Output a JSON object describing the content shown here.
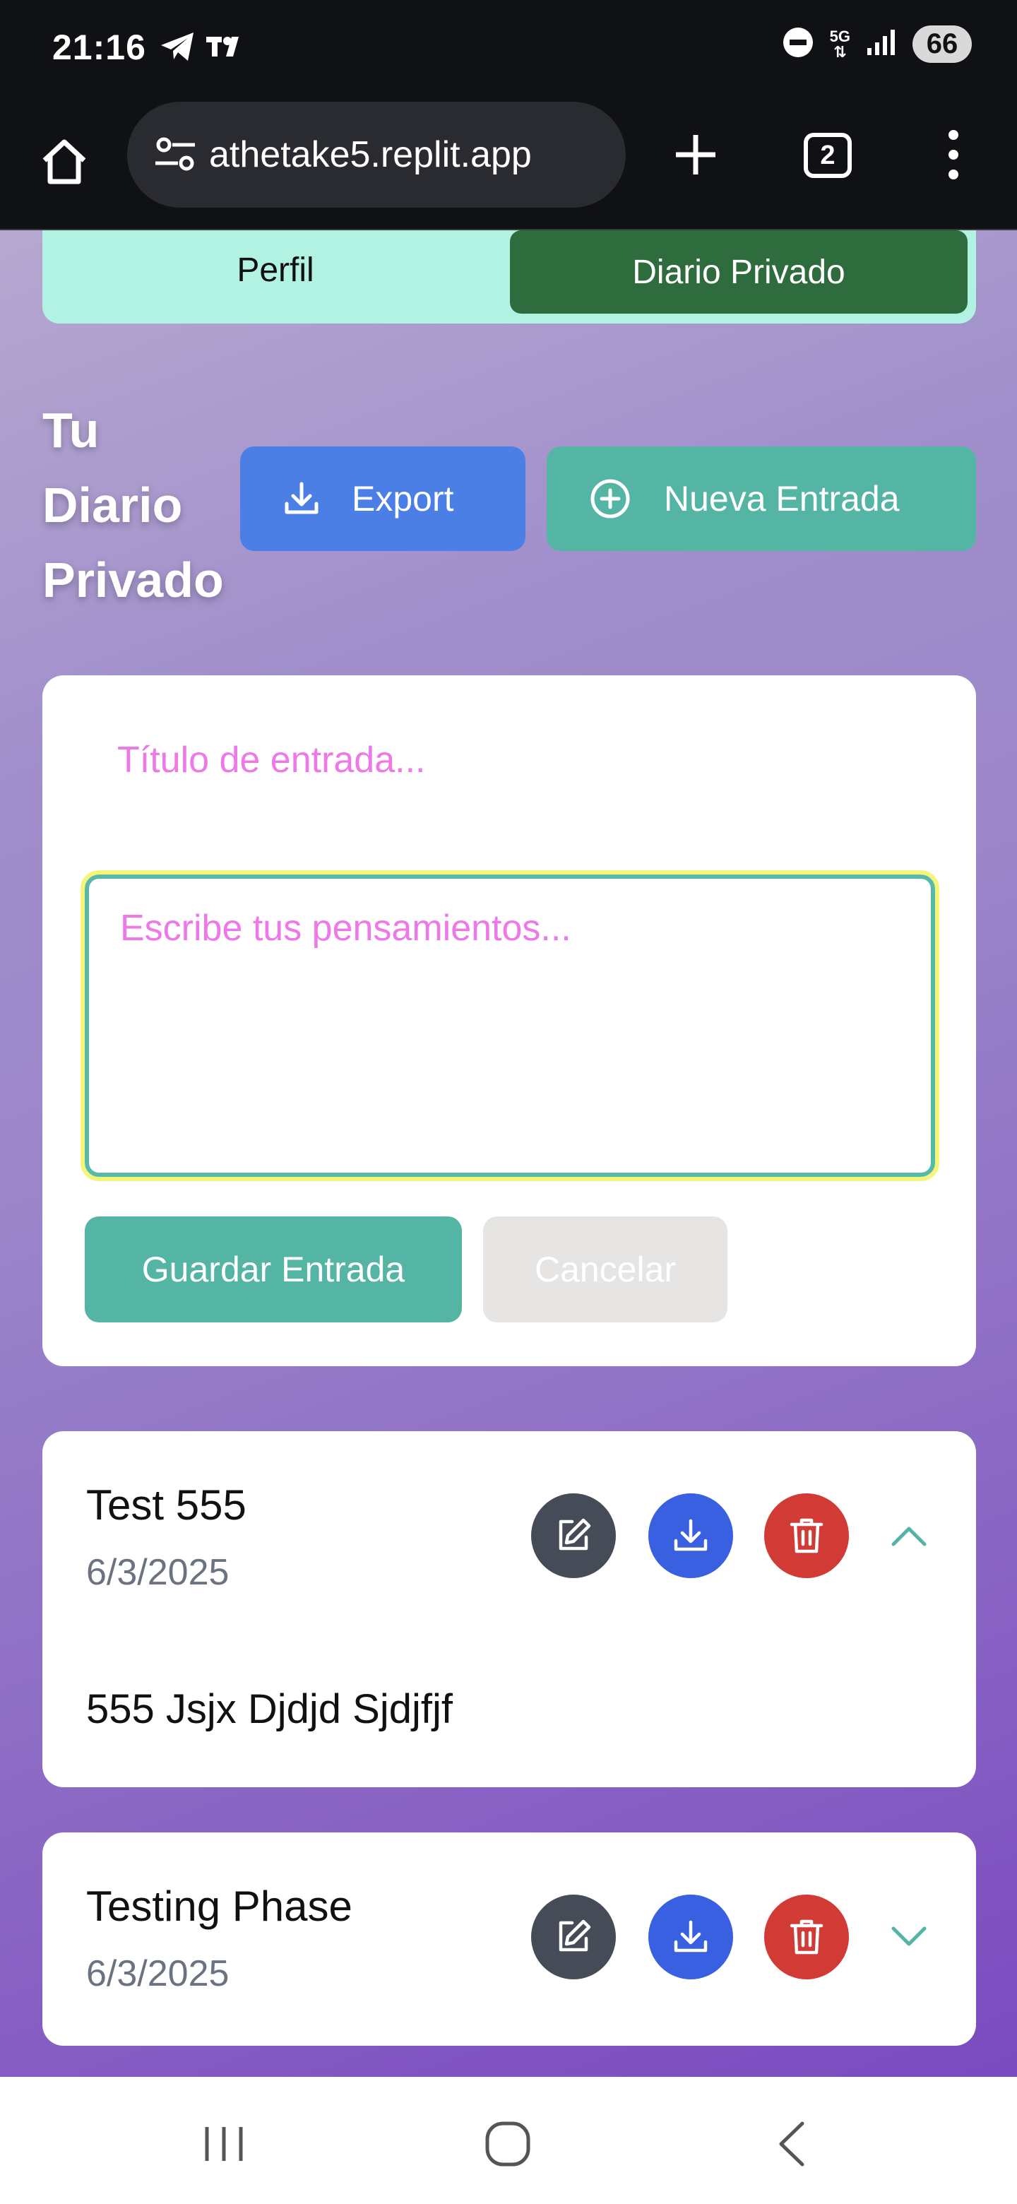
{
  "status_bar": {
    "time": "21:16",
    "network": "5G",
    "battery": "66",
    "left_icons": [
      "telegram-icon",
      "tradingview-icon"
    ],
    "right_icons": [
      "dnd-icon",
      "5g-icon",
      "signal-icon",
      "battery-icon"
    ]
  },
  "browser": {
    "url": "athetake5.replit.app",
    "tab_count": "2"
  },
  "tabs": {
    "perfil": "Perfil",
    "diario": "Diario Privado"
  },
  "diary": {
    "title": "Tu Diario Privado",
    "export_label": "Export",
    "new_entry_label": "Nueva Entrada"
  },
  "editor": {
    "title_placeholder": "Título de entrada...",
    "body_placeholder": "Escribe tus pensamientos...",
    "save_label": "Guardar Entrada",
    "cancel_label": "Cancelar"
  },
  "entries": [
    {
      "title": "Test 555",
      "date": "6/3/2025",
      "body": "555 Jsjx Djdjd Sjdjfjf",
      "expanded": true
    },
    {
      "title": "Testing Phase",
      "date": "6/3/2025",
      "expanded": false
    }
  ],
  "colors": {
    "accent_teal": "#55b5a5",
    "export_blue": "#4b7fe6",
    "tab_active_green": "#2e6b3d",
    "tab_bg": "#b1f2e2",
    "edit_gray": "#454c57",
    "download_blue": "#3960e0",
    "delete_red": "#d23a35",
    "placeholder_pink": "#ef78e8"
  }
}
